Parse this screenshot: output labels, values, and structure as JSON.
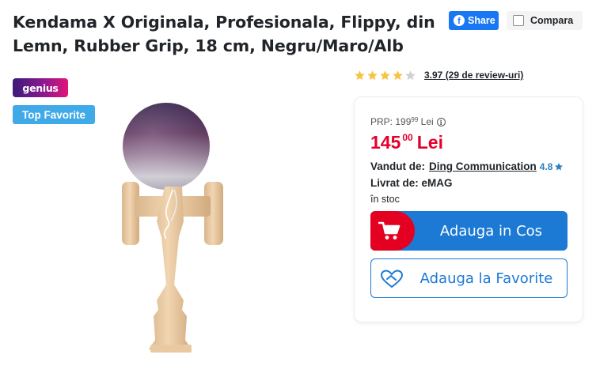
{
  "product": {
    "title": "Kendama X Originala, Profesionala, Flippy, din Lemn, Rubber Grip, 18 cm, Negru/Maro/Alb"
  },
  "header": {
    "share_label": "Share",
    "share_icon": "facebook-icon",
    "compare_label": "Compara"
  },
  "badges": {
    "genius": "genius",
    "top_favorite": "Top Favorite"
  },
  "rating": {
    "value": 3.97,
    "text": "3.97 (29 de review-uri)",
    "stars_filled": 4,
    "stars_total": 5
  },
  "pricing": {
    "prp_label": "PRP:",
    "prp_int": "199",
    "prp_dec": "99",
    "prp_currency": "Lei",
    "price_int": "145",
    "price_dec": "00",
    "price_currency": "Lei"
  },
  "seller": {
    "sold_by_label": "Vandut de:",
    "name": "Ding Communication",
    "rating": "4.8",
    "delivered_by_label": "Livrat de:",
    "delivered_by": "eMAG",
    "stock": "în stoc"
  },
  "actions": {
    "add_to_cart": "Adauga in Cos",
    "add_to_favorites": "Adauga la Favorite"
  },
  "colors": {
    "price_red": "#e4002b",
    "brand_blue": "#1c79d4",
    "cart_red": "#e40021",
    "star_gold": "#f5c542",
    "facebook_blue": "#1877f2",
    "top_fav_blue": "#40a9e8"
  }
}
